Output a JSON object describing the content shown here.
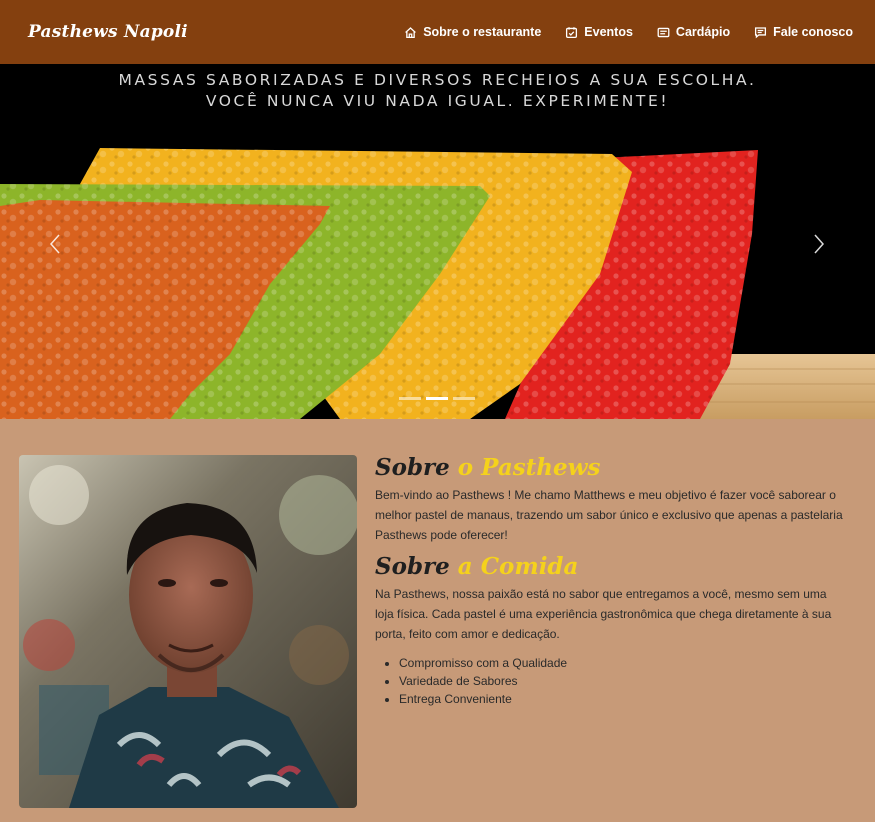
{
  "brand": "Pasthews Napoli",
  "nav": [
    {
      "icon": "home-icon",
      "label": "Sobre o restaurante"
    },
    {
      "icon": "calendar-check-icon",
      "label": "Eventos"
    },
    {
      "icon": "menu-card-icon",
      "label": "Cardápio"
    },
    {
      "icon": "chat-icon",
      "label": "Fale conosco"
    }
  ],
  "carousel": {
    "caption_line1": "MASSAS SABORIZADAS E DIVERSOS RECHEIOS A SUA ESCOLHA.",
    "caption_line2": "VOCÊ NUNCA VIU NADA IGUAL. EXPERIMENTE!",
    "slide_count": 3,
    "active_slide": 2
  },
  "about": {
    "title_main": "Sobre ",
    "title_accent": "o Pasthews",
    "intro": "Bem-vindo ao Pasthews ! Me chamo Matthews e meu objetivo é fazer você saborear o melhor pastel de manaus, trazendo um sabor único e exclusivo que apenas a pastelaria Pasthews pode oferecer!",
    "food_title_main": "Sobre ",
    "food_title_accent": "a Comida",
    "food_text": "Na Pasthews, nossa paixão está no sabor que entregamos a você, mesmo sem uma loja física. Cada pastel é uma experiência gastronômica que chega diretamente à sua porta, feito com amor e dedicação.",
    "features": [
      "Compromisso com a Qualidade",
      "Variedade de Sabores",
      "Entrega Conveniente"
    ]
  },
  "colors": {
    "navbar": "#84400f",
    "page_background": "#c79a78",
    "accent": "#f5d21b"
  }
}
